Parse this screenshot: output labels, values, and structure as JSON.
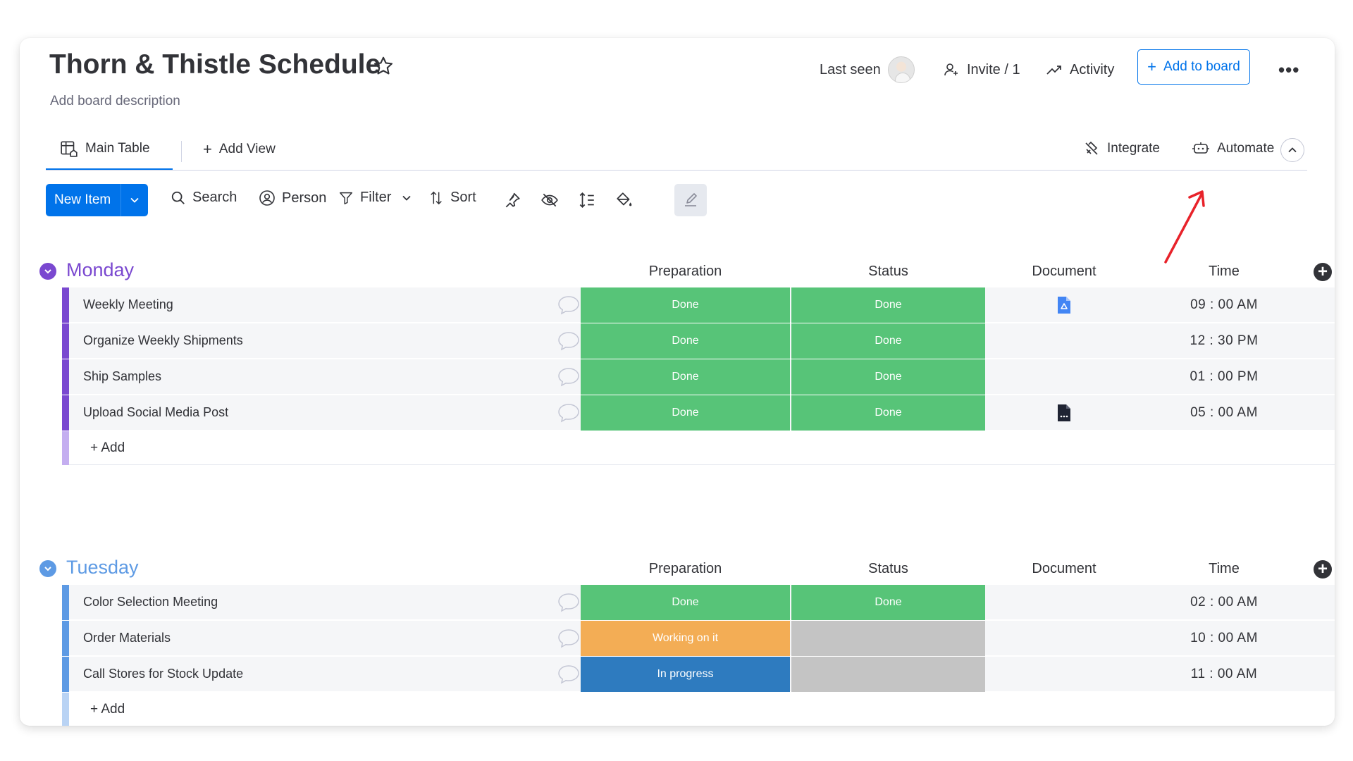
{
  "board": {
    "title": "Thorn & Thistle Schedule",
    "description": "Add board description",
    "last_seen_label": "Last seen",
    "invite_label": "Invite / 1",
    "activity_label": "Activity",
    "add_to_board_label": "Add to board"
  },
  "views": {
    "main_tab_label": "Main Table",
    "add_view_label": "Add View",
    "integrate_label": "Integrate",
    "automate_label": "Automate"
  },
  "toolbar": {
    "new_item_label": "New Item",
    "search_label": "Search",
    "person_label": "Person",
    "filter_label": "Filter",
    "sort_label": "Sort"
  },
  "columns": {
    "preparation": "Preparation",
    "status": "Status",
    "document": "Document",
    "time": "Time"
  },
  "colors": {
    "done": "#57c478",
    "working": "#f3ad55",
    "in_progress": "#2e7bbf",
    "empty": "#c4c4c4",
    "monday": "#7a48d0",
    "tuesday": "#5d9ae4",
    "accent": "#0073ea"
  },
  "groups": [
    {
      "name": "Monday",
      "color": "#7a48d0",
      "add_label": "+ Add",
      "items": [
        {
          "name": "Weekly Meeting",
          "preparation": "Done",
          "status": "Done",
          "document": "google-drive-file-icon",
          "time": "09 : 00 AM"
        },
        {
          "name": "Organize Weekly Shipments",
          "preparation": "Done",
          "status": "Done",
          "document": "",
          "time": "12 : 30 PM"
        },
        {
          "name": "Ship Samples",
          "preparation": "Done",
          "status": "Done",
          "document": "",
          "time": "01 : 00 PM"
        },
        {
          "name": "Upload Social Media Post",
          "preparation": "Done",
          "status": "Done",
          "document": "document-file-icon",
          "time": "05 : 00 AM"
        }
      ]
    },
    {
      "name": "Tuesday",
      "color": "#5d9ae4",
      "add_label": "+ Add",
      "items": [
        {
          "name": "Color Selection Meeting",
          "preparation": "Done",
          "status": "Done",
          "document": "",
          "time": "02 : 00 AM"
        },
        {
          "name": "Order Materials",
          "preparation": "Working on it",
          "status": "",
          "document": "",
          "time": "10 : 00 AM"
        },
        {
          "name": "Call Stores for Stock Update",
          "preparation": "In progress",
          "status": "",
          "document": "",
          "time": "11 : 00 AM"
        }
      ]
    }
  ]
}
